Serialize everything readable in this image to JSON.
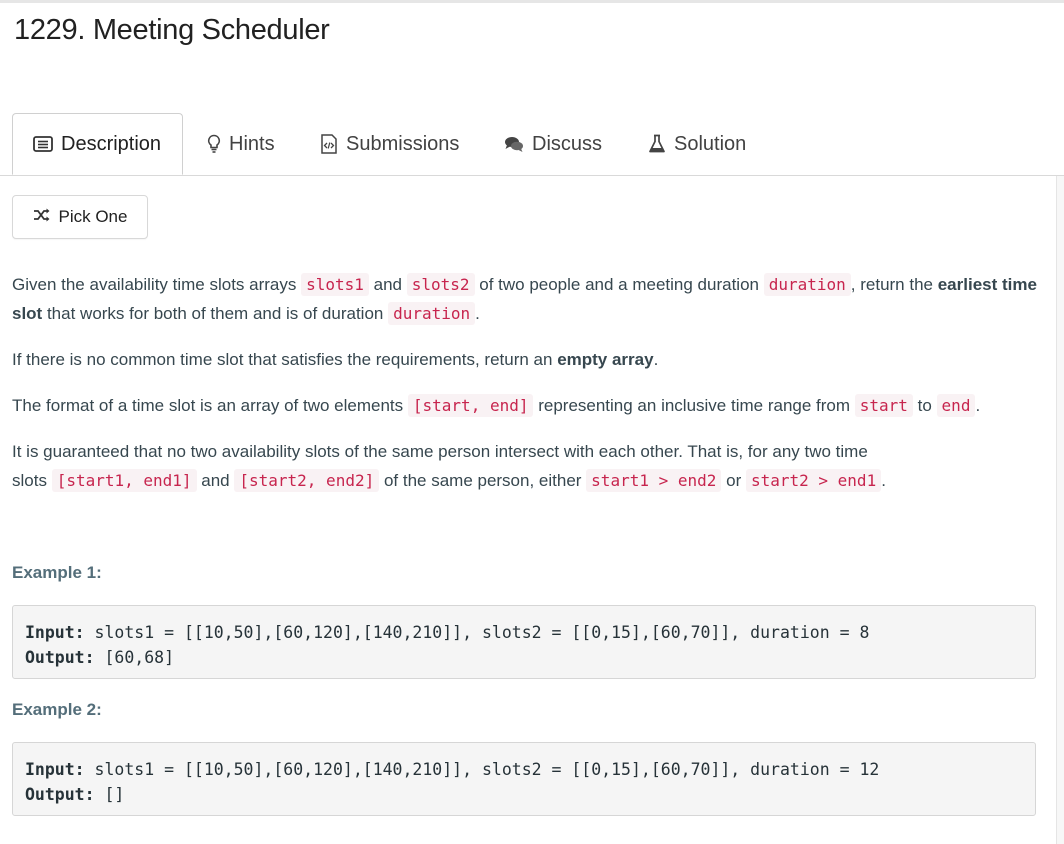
{
  "problem": {
    "title": "1229. Meeting Scheduler"
  },
  "tabs": [
    {
      "label": "Description",
      "icon": "description-icon",
      "active": true
    },
    {
      "label": "Hints",
      "icon": "lightbulb-icon"
    },
    {
      "label": "Submissions",
      "icon": "code-file-icon"
    },
    {
      "label": "Discuss",
      "icon": "chat-bubbles-icon"
    },
    {
      "label": "Solution",
      "icon": "flask-icon"
    }
  ],
  "pick_one": {
    "label": "Pick One",
    "icon": "shuffle-icon"
  },
  "description": {
    "p1": {
      "t1": "Given the availability time slots arrays ",
      "c1": "slots1",
      "t2": " and ",
      "c2": "slots2",
      "t3": " of two people and a meeting duration ",
      "c3": "duration",
      "t4": ", return the ",
      "b1": "earliest time slot",
      "t5": " that works for both of them and is of duration ",
      "c4": "duration",
      "t6": "."
    },
    "p2": {
      "t1": "If there is no common time slot that satisfies the requirements, return an ",
      "b1": "empty array",
      "t2": "."
    },
    "p3": {
      "t1": "The format of a time slot is an array of two elements ",
      "c1": "[start, end]",
      "t2": " representing an inclusive time range from ",
      "c2": "start",
      "t3": " to ",
      "c3": "end",
      "t4": "."
    },
    "p4": {
      "t1": "It is guaranteed that no two availability slots of the same person intersect with each other. That is, for any two time",
      "t1b": "slots ",
      "c1": "[start1, end1]",
      "t2": " and ",
      "c2": "[start2, end2]",
      "t3": " of the same person, either ",
      "c3": "start1 > end2",
      "t4": " or ",
      "c4": "start2 > end1",
      "t5": "."
    }
  },
  "examples": [
    {
      "label": "Example 1:",
      "input_label": "Input:",
      "input": " slots1 = [[10,50],[60,120],[140,210]], slots2 = [[0,15],[60,70]], duration = 8",
      "output_label": "Output:",
      "output": " [60,68]"
    },
    {
      "label": "Example 2:",
      "input_label": "Input:",
      "input": " slots1 = [[10,50],[60,120],[140,210]], slots2 = [[0,15],[60,70]], duration = 12",
      "output_label": "Output:",
      "output": " []"
    }
  ]
}
